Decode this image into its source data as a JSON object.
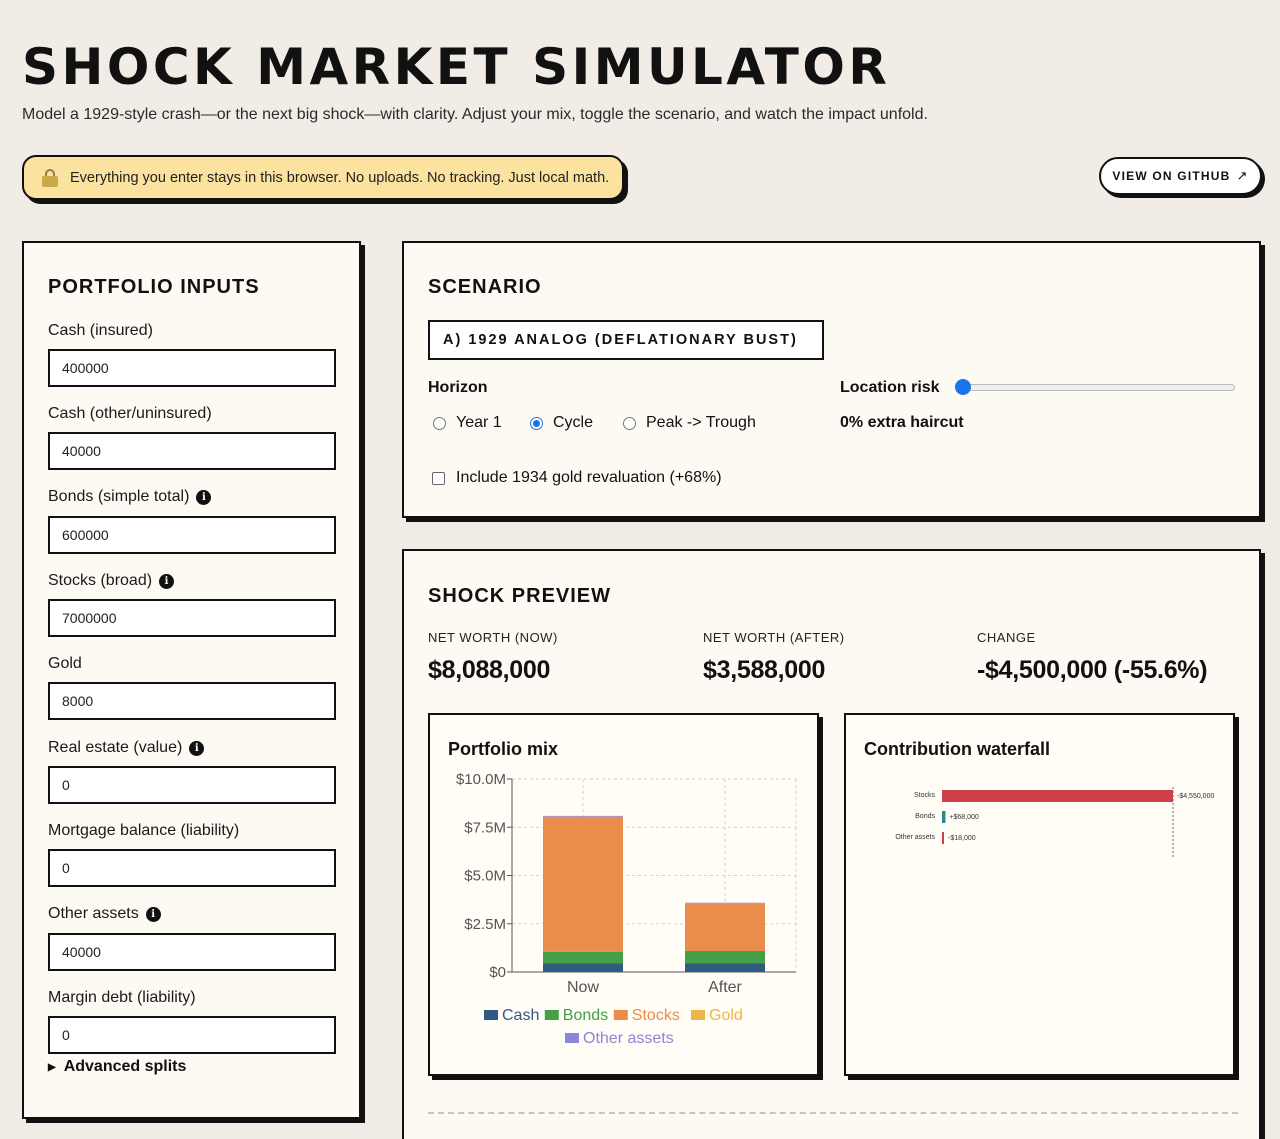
{
  "header": {
    "title": "SHOCK MARKET SIMULATOR",
    "subtitle": "Model a 1929-style crash—or the next big shock—with clarity. Adjust your mix, toggle the scenario, and watch the impact unfold.",
    "privacy_note": "Everything you enter stays in this browser. No uploads. No tracking. Just local math.",
    "github_label": "VIEW ON GITHUB",
    "github_icon": "external-arrow-icon"
  },
  "inputs": {
    "title": "PORTFOLIO INPUTS",
    "fields": [
      {
        "label": "Cash (insured)",
        "value": "400000",
        "info": false
      },
      {
        "label": "Cash (other/uninsured)",
        "value": "40000",
        "info": false
      },
      {
        "label": "Bonds (simple total)",
        "value": "600000",
        "info": true
      },
      {
        "label": "Stocks (broad)",
        "value": "7000000",
        "info": true
      },
      {
        "label": "Gold",
        "value": "8000",
        "info": false
      },
      {
        "label": "Real estate (value)",
        "value": "0",
        "info": true
      },
      {
        "label": "Mortgage balance (liability)",
        "value": "0",
        "info": false
      },
      {
        "label": "Other assets",
        "value": "40000",
        "info": true
      },
      {
        "label": "Margin debt (liability)",
        "value": "0",
        "info": false
      }
    ],
    "advanced_label": "Advanced splits"
  },
  "scenario": {
    "title": "SCENARIO",
    "selected": "A) 1929 ANALOG (DEFLATIONARY BUST)",
    "horizon_label": "Horizon",
    "horizon_options": [
      "Year 1",
      "Cycle",
      "Peak -> Trough"
    ],
    "horizon_selected": "Cycle",
    "gold_checkbox_label": "Include 1934 gold revaluation (+68%)",
    "gold_checked": false,
    "location_risk_label": "Location risk",
    "location_risk_value": 0,
    "location_risk_text": "0% extra haircut"
  },
  "preview": {
    "title": "SHOCK PREVIEW",
    "stats": [
      {
        "label": "NET WORTH (NOW)",
        "value": "$8,088,000"
      },
      {
        "label": "NET WORTH (AFTER)",
        "value": "$3,588,000"
      },
      {
        "label": "CHANGE",
        "value": "-$4,500,000 (-55.6%)"
      }
    ],
    "mix_title": "Portfolio mix",
    "waterfall_title": "Contribution waterfall"
  },
  "colors": {
    "cash": "#2f5a82",
    "bonds": "#43a047",
    "stocks": "#ea8c4a",
    "gold": "#efb548",
    "other": "#8c86d6",
    "negative": "#cf3f4a",
    "positive": "#2a8a8a"
  },
  "chart_data": [
    {
      "type": "bar",
      "stacked": true,
      "title": "Portfolio mix",
      "categories": [
        "Now",
        "After"
      ],
      "y_ticks": [
        "$0",
        "$2.5M",
        "$5.0M",
        "$7.5M",
        "$10.0M"
      ],
      "ylim": [
        0,
        10000000
      ],
      "series": [
        {
          "name": "Cash",
          "values": [
            440000,
            440000
          ]
        },
        {
          "name": "Bonds",
          "values": [
            600000,
            650000
          ]
        },
        {
          "name": "Stocks",
          "values": [
            7000000,
            2450000
          ]
        },
        {
          "name": "Gold",
          "values": [
            8000,
            8000
          ]
        },
        {
          "name": "Other assets",
          "values": [
            40000,
            40000
          ]
        }
      ],
      "grid": true,
      "legend": "bottom"
    },
    {
      "type": "bar",
      "orientation": "horizontal",
      "title": "Contribution waterfall",
      "categories": [
        "Stocks",
        "Bonds",
        "Other assets"
      ],
      "values": [
        -4550000,
        68000,
        -18000
      ],
      "labels": [
        "-$4,550,000",
        "+$68,000",
        "-$18,000"
      ]
    }
  ]
}
